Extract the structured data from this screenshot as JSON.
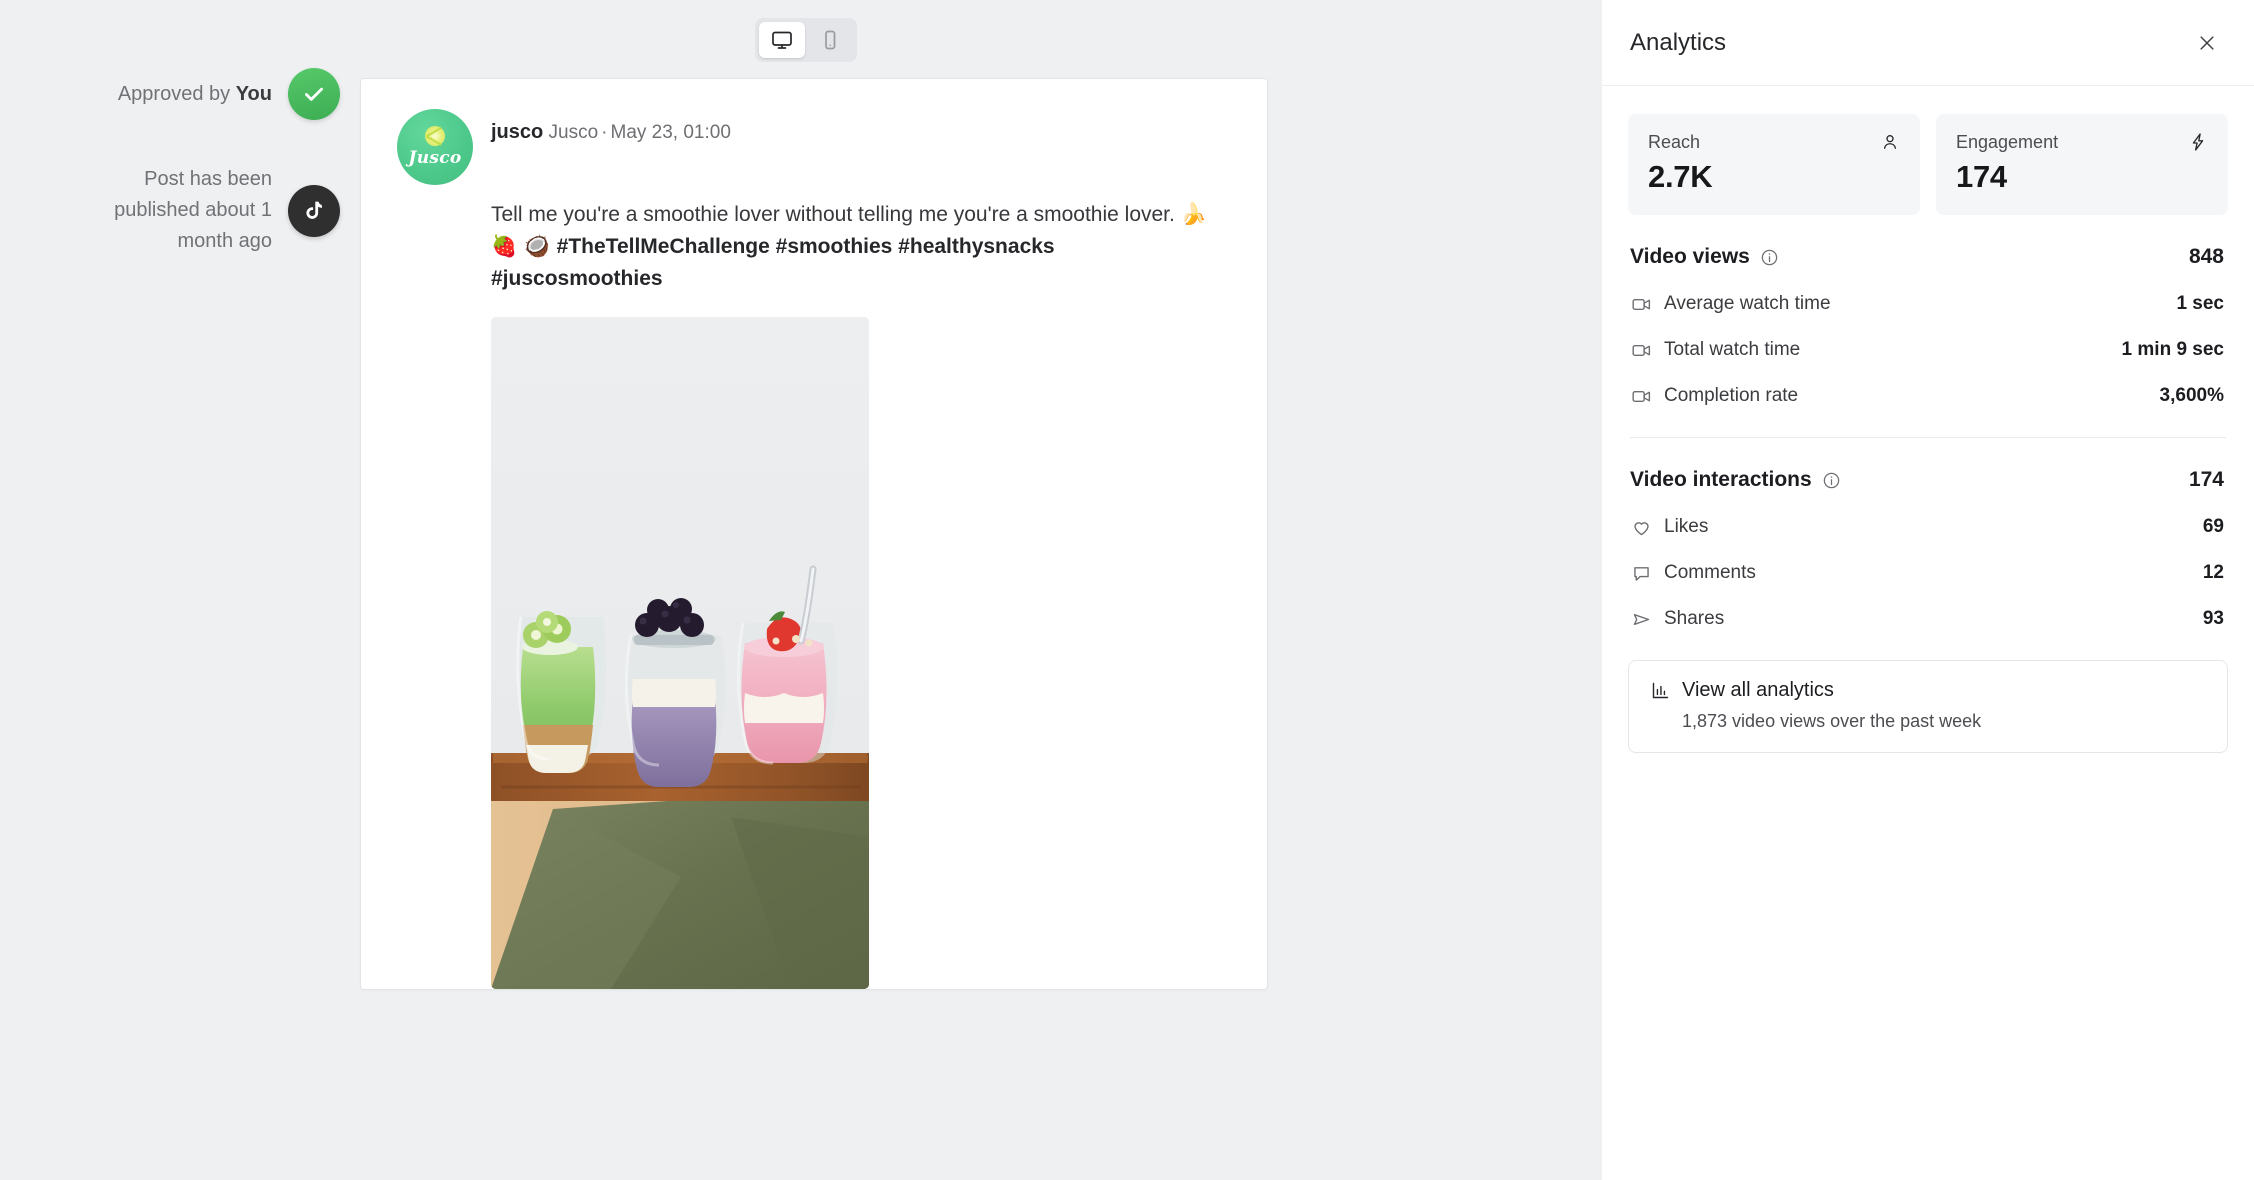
{
  "device_toggle": {
    "desktop_label": "Desktop preview",
    "mobile_label": "Mobile preview",
    "selected": "desktop"
  },
  "status": {
    "approved_prefix": "Approved by ",
    "approved_actor": "You",
    "published_text": "Post has been published about 1 month ago",
    "network": "TikTok",
    "approved_color": "#49be5e",
    "network_color": "#2f2f2f"
  },
  "post": {
    "handle": "jusco",
    "display_name": "Jusco",
    "separator": "·",
    "timestamp": "May 23, 01:00",
    "avatar_brand": "Jusco",
    "caption_line1": "Tell me you're a smoothie lover without telling me you're a smoothie lover. ",
    "caption_emojis": "🍌 🍓 🥥 ",
    "hashtags": "#TheTellMeChallenge #smoothies #healthysnacks #juscosmoothies",
    "image_alt": "Three layered smoothie jars on a wooden board"
  },
  "analytics": {
    "title": "Analytics",
    "close_label": "Close analytics",
    "kpis": [
      {
        "label": "Reach",
        "value": "2.7K",
        "icon": "person-icon"
      },
      {
        "label": "Engagement",
        "value": "174",
        "icon": "lightning-icon"
      }
    ],
    "sections": [
      {
        "title": "Video views",
        "total": "848",
        "metrics": [
          {
            "icon": "video-icon",
            "label": "Average watch time",
            "value": "1 sec"
          },
          {
            "icon": "video-icon",
            "label": "Total watch time",
            "value": "1 min 9 sec"
          },
          {
            "icon": "video-icon",
            "label": "Completion rate",
            "value": "3,600%"
          }
        ]
      },
      {
        "title": "Video interactions",
        "total": "174",
        "metrics": [
          {
            "icon": "heart-icon",
            "label": "Likes",
            "value": "69"
          },
          {
            "icon": "comment-icon",
            "label": "Comments",
            "value": "12"
          },
          {
            "icon": "share-icon",
            "label": "Shares",
            "value": "93"
          }
        ]
      }
    ],
    "view_all": {
      "title": "View all analytics",
      "subtitle": "1,873 video views over the past week"
    }
  },
  "theme": {
    "page_bg": "#eff0f2",
    "panel_bg": "#ffffff",
    "card_bg": "#f4f6f8",
    "text_primary": "#1c1d20",
    "text_secondary": "#6e6f73"
  }
}
